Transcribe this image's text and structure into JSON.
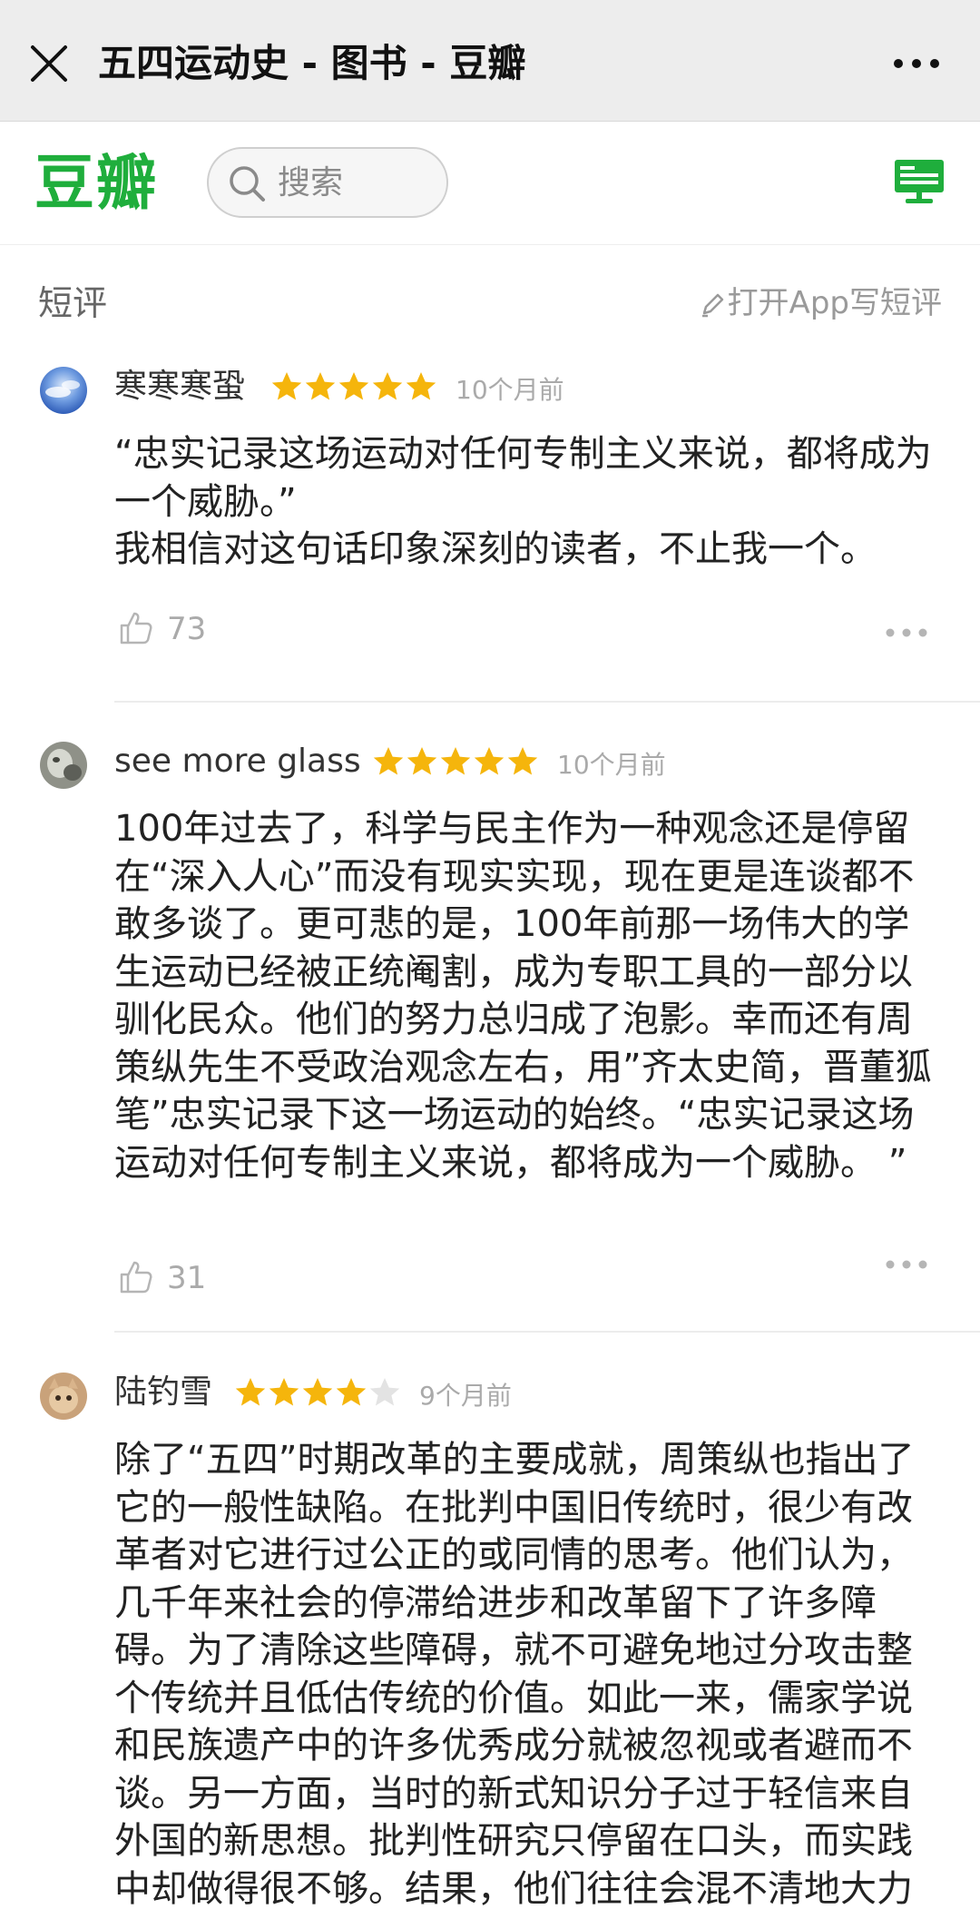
{
  "window": {
    "title": "五四运动史 - 图书 - 豆瓣"
  },
  "header": {
    "logo_text": "豆瓣",
    "search_placeholder": "搜索",
    "brand_color": "#1fae3c"
  },
  "section": {
    "title": "短评",
    "write_link": "打开App写短评"
  },
  "reviews": [
    {
      "author": "寒寒寒蛩",
      "rating": 5,
      "max_rating": 5,
      "time": "10个月前",
      "lines": [
        "“忠实记录这场运动对任何专制主义来说，都将成为",
        "一个威胁。”",
        "我相信对这句话印象深刻的读者，不止我一个。"
      ],
      "likes": "73"
    },
    {
      "author": "see more glass",
      "rating": 5,
      "max_rating": 5,
      "time": "10个月前",
      "lines": [
        "100年过去了，科学与民主作为一种观念还是停留",
        "在“深入人心”而没有现实实现，现在更是连谈都不",
        "敢多谈了。更可悲的是，100年前那一场伟大的学",
        "生运动已经被正统阉割，成为专职工具的一部分以",
        "驯化民众。他们的努力总归成了泡影。幸而还有周",
        "策纵先生不受政治观念左右，用”齐太史简，晋董狐",
        "笔”忠实记录下这一场运动的始终。“忠实记录这场",
        "运动对任何专制主义来说，都将成为一个威胁。 ”"
      ],
      "likes": "31"
    },
    {
      "author": "陆钓雪",
      "rating": 4,
      "max_rating": 5,
      "time": "9个月前",
      "lines": [
        "除了“五四”时期改革的主要成就，周策纵也指出了",
        "它的一般性缺陷。在批判中国旧传统时，很少有改",
        "革者对它进行过公正的或同情的思考。他们认为，",
        "几千年来社会的停滞给进步和改革留下了许多障",
        "碍。为了清除这些障碍，就不可避免地过分攻击整",
        "个传统并且低估传统的价值。如此一来，儒家学说",
        "和民族遗产中的许多优秀成分就被忽视或者避而不",
        "谈。另一方面，当时的新式知识分子过于轻信来自",
        "外国的新思想。批判性研究只停留在口头，而实践",
        "中却做得很不够。结果，他们往往会混不清地大力"
      ],
      "likes": ""
    }
  ],
  "colors": {
    "star_filled": "#f5b50c",
    "star_empty": "#e3e3e3",
    "meta_gray": "#aaaaaa"
  }
}
